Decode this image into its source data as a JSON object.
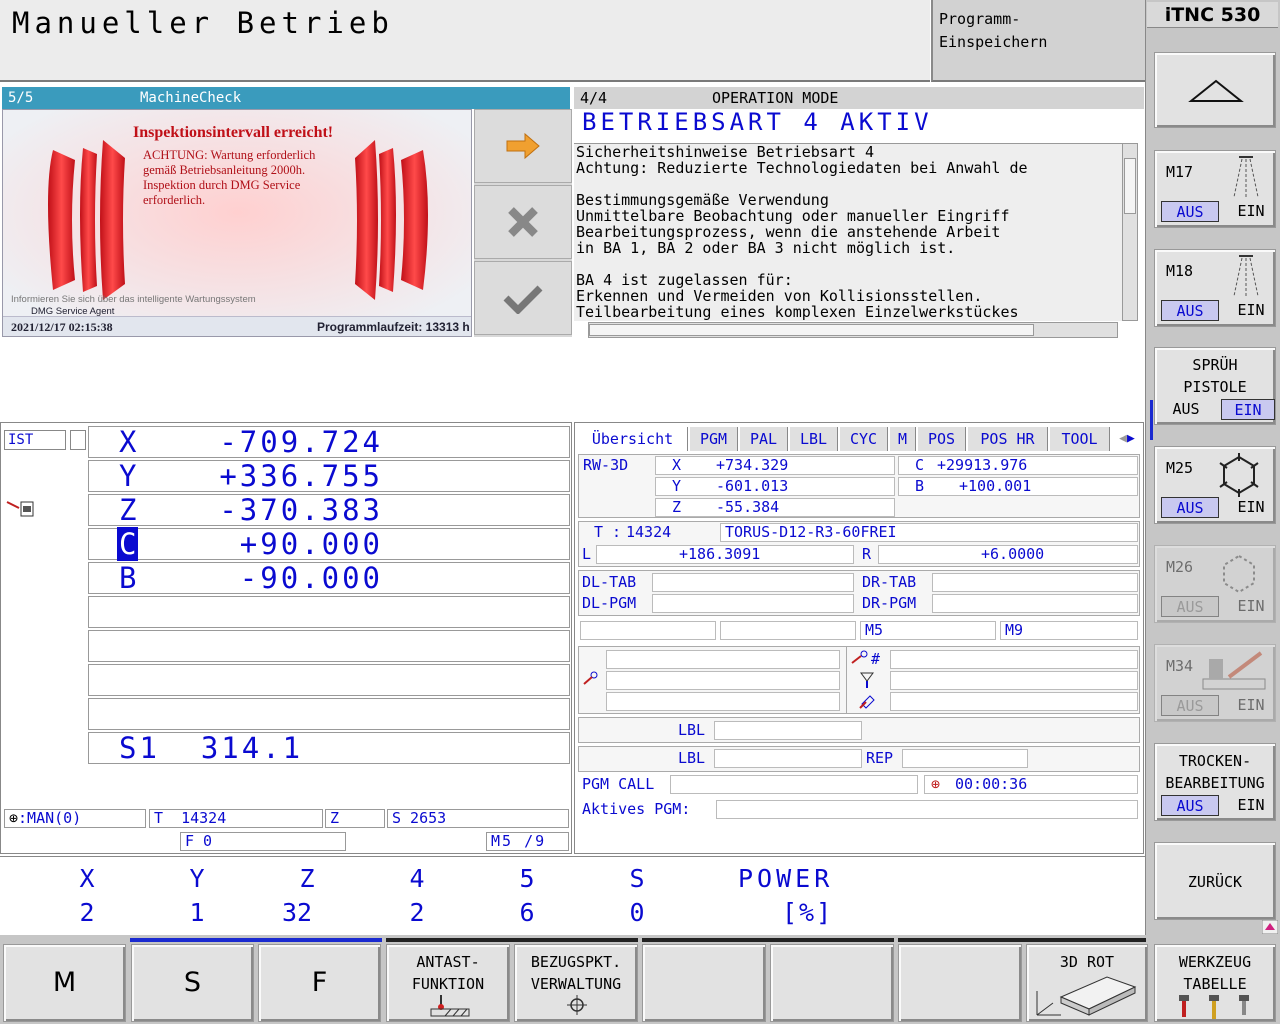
{
  "header": {
    "title": "Manueller Betrieb",
    "program_store": "Programm-\nEinspeichern",
    "brand": "iTNC 530"
  },
  "sidebar": {
    "m17": {
      "label": "M17",
      "off": "AUS",
      "on": "EIN"
    },
    "m18": {
      "label": "M18",
      "off": "AUS",
      "on": "EIN"
    },
    "spray": {
      "line1": "SPRÜH",
      "line2": "PISTOLE",
      "off": "AUS",
      "on": "EIN"
    },
    "m25": {
      "label": "M25",
      "off": "AUS",
      "on": "EIN"
    },
    "m26": {
      "label": "M26",
      "off": "AUS",
      "on": "EIN"
    },
    "m34": {
      "label": "M34",
      "off": "AUS",
      "on": "EIN"
    },
    "dry": {
      "line1": "TROCKEN-",
      "line2": "BEARBEITUNG",
      "off": "AUS",
      "on": "EIN"
    },
    "back": "ZURÜCK"
  },
  "machinecheck": {
    "page": "5/5",
    "title": "MachineCheck",
    "alert_title": "Inspektionsintervall erreicht!",
    "alert_line1": "ACHTUNG: Wartung erforderlich",
    "alert_line2": "gemäß Betriebsanleitung 2000h.",
    "alert_line3": "Inspektion durch DMG Service",
    "alert_line4": "erforderlich.",
    "info_line": "Informieren Sie sich über das intelligente Wartungssystem",
    "agent": "DMG Service Agent",
    "datetime": "2021/12/17 02:15:38",
    "runtime": "Programmlaufzeit: 13313 h"
  },
  "opmode": {
    "page": "4/4",
    "title": "OPERATION MODE",
    "banner": "BETRIEBSART 4 AKTIV",
    "text": "Sicherheitshinweise Betriebsart 4\nAchtung: Reduzierte Technologiedaten bei Anwahl de\n\nBestimmungsgemäße Verwendung\nUnmittelbare Beobachtung oder manueller Eingriff\nBearbeitungsprozess, wenn die anstehende Arbeit\nin BA 1, BA 2 oder BA 3 nicht möglich ist.\n\nBA 4 ist zugelassen für:\nErkennen und Vermeiden von Kollisionsstellen.\nTeilbearbeitung eines komplexen Einzelwerkstückes"
  },
  "position": {
    "mode": "IST",
    "axes": [
      {
        "name": "X",
        "value": "-709.724"
      },
      {
        "name": "Y",
        "value": "+336.755"
      },
      {
        "name": "Z",
        "value": "-370.383"
      },
      {
        "name": "C",
        "value": "+90.000"
      },
      {
        "name": "B",
        "value": "-90.000"
      }
    ],
    "spindle": "S1  314.1",
    "man": ":MAN(0)",
    "tool_label": "T",
    "tool_value": "14324",
    "z_label": "Z",
    "speed": "S 2653",
    "feed": "F 0",
    "mfunc": "M5 /9"
  },
  "status": {
    "tabs": [
      "Übersicht",
      "PGM",
      "PAL",
      "LBL",
      "CYC",
      "M",
      "POS",
      "POS HR",
      "TOOL"
    ],
    "rw": "RW-3D",
    "x_label": "X",
    "x_value": "+734.329",
    "y_label": "Y",
    "y_value": "-601.013",
    "z_label": "Z",
    "z_value": "-55.384",
    "c_label": "C",
    "c_value": "+29913.976",
    "b_label": "B",
    "b_value": "+100.001",
    "t_label": "T :",
    "t_value": "14324",
    "tool_name": "TORUS-D12-R3-60FREI",
    "l_label": "L",
    "l_value": "+186.3091",
    "r_label": "R",
    "r_value": "+6.0000",
    "dl_tab": "DL-TAB",
    "dr_tab": "DR-TAB",
    "dl_pgm": "DL-PGM",
    "dr_pgm": "DR-PGM",
    "m5": "M5",
    "m9": "M9",
    "lbl1": "LBL",
    "lbl2": "LBL",
    "rep": "REP",
    "pgm_call": "PGM CALL",
    "time": "00:00:36",
    "active_pgm": "Aktives PGM:",
    "hash": "#"
  },
  "counters": {
    "labels": [
      "X",
      "Y",
      "Z",
      "4",
      "5",
      "S"
    ],
    "values": [
      "2",
      "1",
      "32",
      "2",
      "6",
      "0"
    ],
    "power_label": "POWER",
    "power_unit": "[%]"
  },
  "softkeys": {
    "m": "M",
    "s": "S",
    "f": "F",
    "probe1": "ANTAST-",
    "probe2": "FUNKTION",
    "datum1": "BEZUGSPKT.",
    "datum2": "VERWALTUNG",
    "rot": "3D ROT",
    "tool1": "WERKZEUG",
    "tool2": "TABELLE"
  }
}
